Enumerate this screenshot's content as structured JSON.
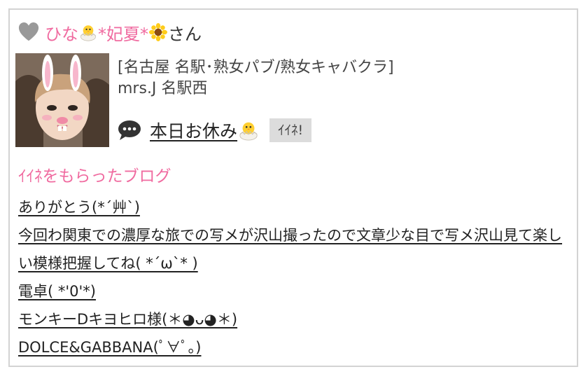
{
  "header": {
    "name_part1": "ひな",
    "name_part2": "*妃夏*",
    "suffix": "さん",
    "colors": {
      "heart": "#999999",
      "name": "#f06ba0",
      "section_title": "#f06ba0"
    },
    "icons": [
      "heart-icon",
      "chick-emoji-icon",
      "sunflower-emoji-icon"
    ]
  },
  "shop": {
    "line1": "[名古屋 名駅･熟女パブ/熟女キャバクラ]",
    "line2": "mrs.J 名駅西"
  },
  "status": {
    "text": "本日お休み",
    "iine_button": "ｲｲﾈ!",
    "icons": [
      "speech-bubble-icon",
      "chick-emoji-icon"
    ]
  },
  "section": {
    "title": "ｲｲﾈをもらったブログ"
  },
  "blogs": [
    "ありがとう(*´艸`)",
    "今回わ関東での濃厚な旅での写メが沢山撮ったので文章少な目で写メ沢山見て楽しい模様把握してね( *´ω`* )",
    "電卓( *'0'*)",
    "モンキーDキヨヒロ様(＊◕ᴗ◕＊)",
    "DOLCE&GABBANA(ﾟ∀ﾟ｡)"
  ]
}
